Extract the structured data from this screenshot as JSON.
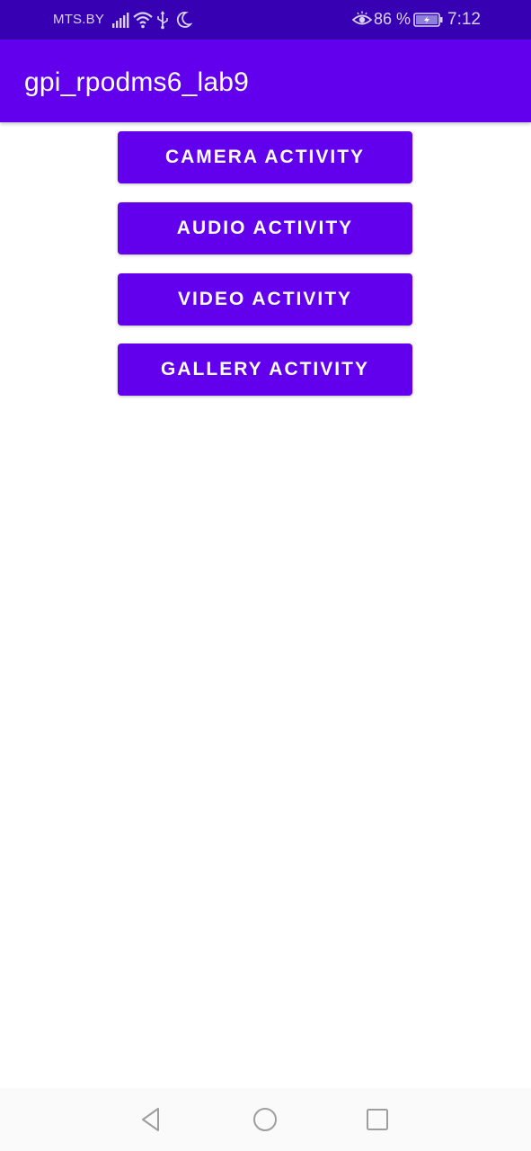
{
  "status_bar": {
    "carrier": "MTS.BY",
    "battery_percent": "86 %",
    "time": "7:12",
    "icons": [
      "signal-icon",
      "wifi-icon",
      "usb-icon",
      "do-not-disturb-moon-icon",
      "eye-comfort-icon",
      "battery-charging-icon"
    ]
  },
  "app_bar": {
    "title": "gpi_rpodms6_lab9"
  },
  "buttons": [
    {
      "label": "CAMERA ACTIVITY"
    },
    {
      "label": "AUDIO ACTIVITY"
    },
    {
      "label": "VIDEO ACTIVITY"
    },
    {
      "label": "GALLERY ACTIVITY"
    }
  ],
  "nav_bar": {
    "icons": [
      "back-icon",
      "home-icon",
      "recents-icon"
    ]
  },
  "colors": {
    "status_bar": "#3700b3",
    "primary": "#6200ee",
    "background": "#ffffff",
    "nav_bar": "#fafafa"
  }
}
